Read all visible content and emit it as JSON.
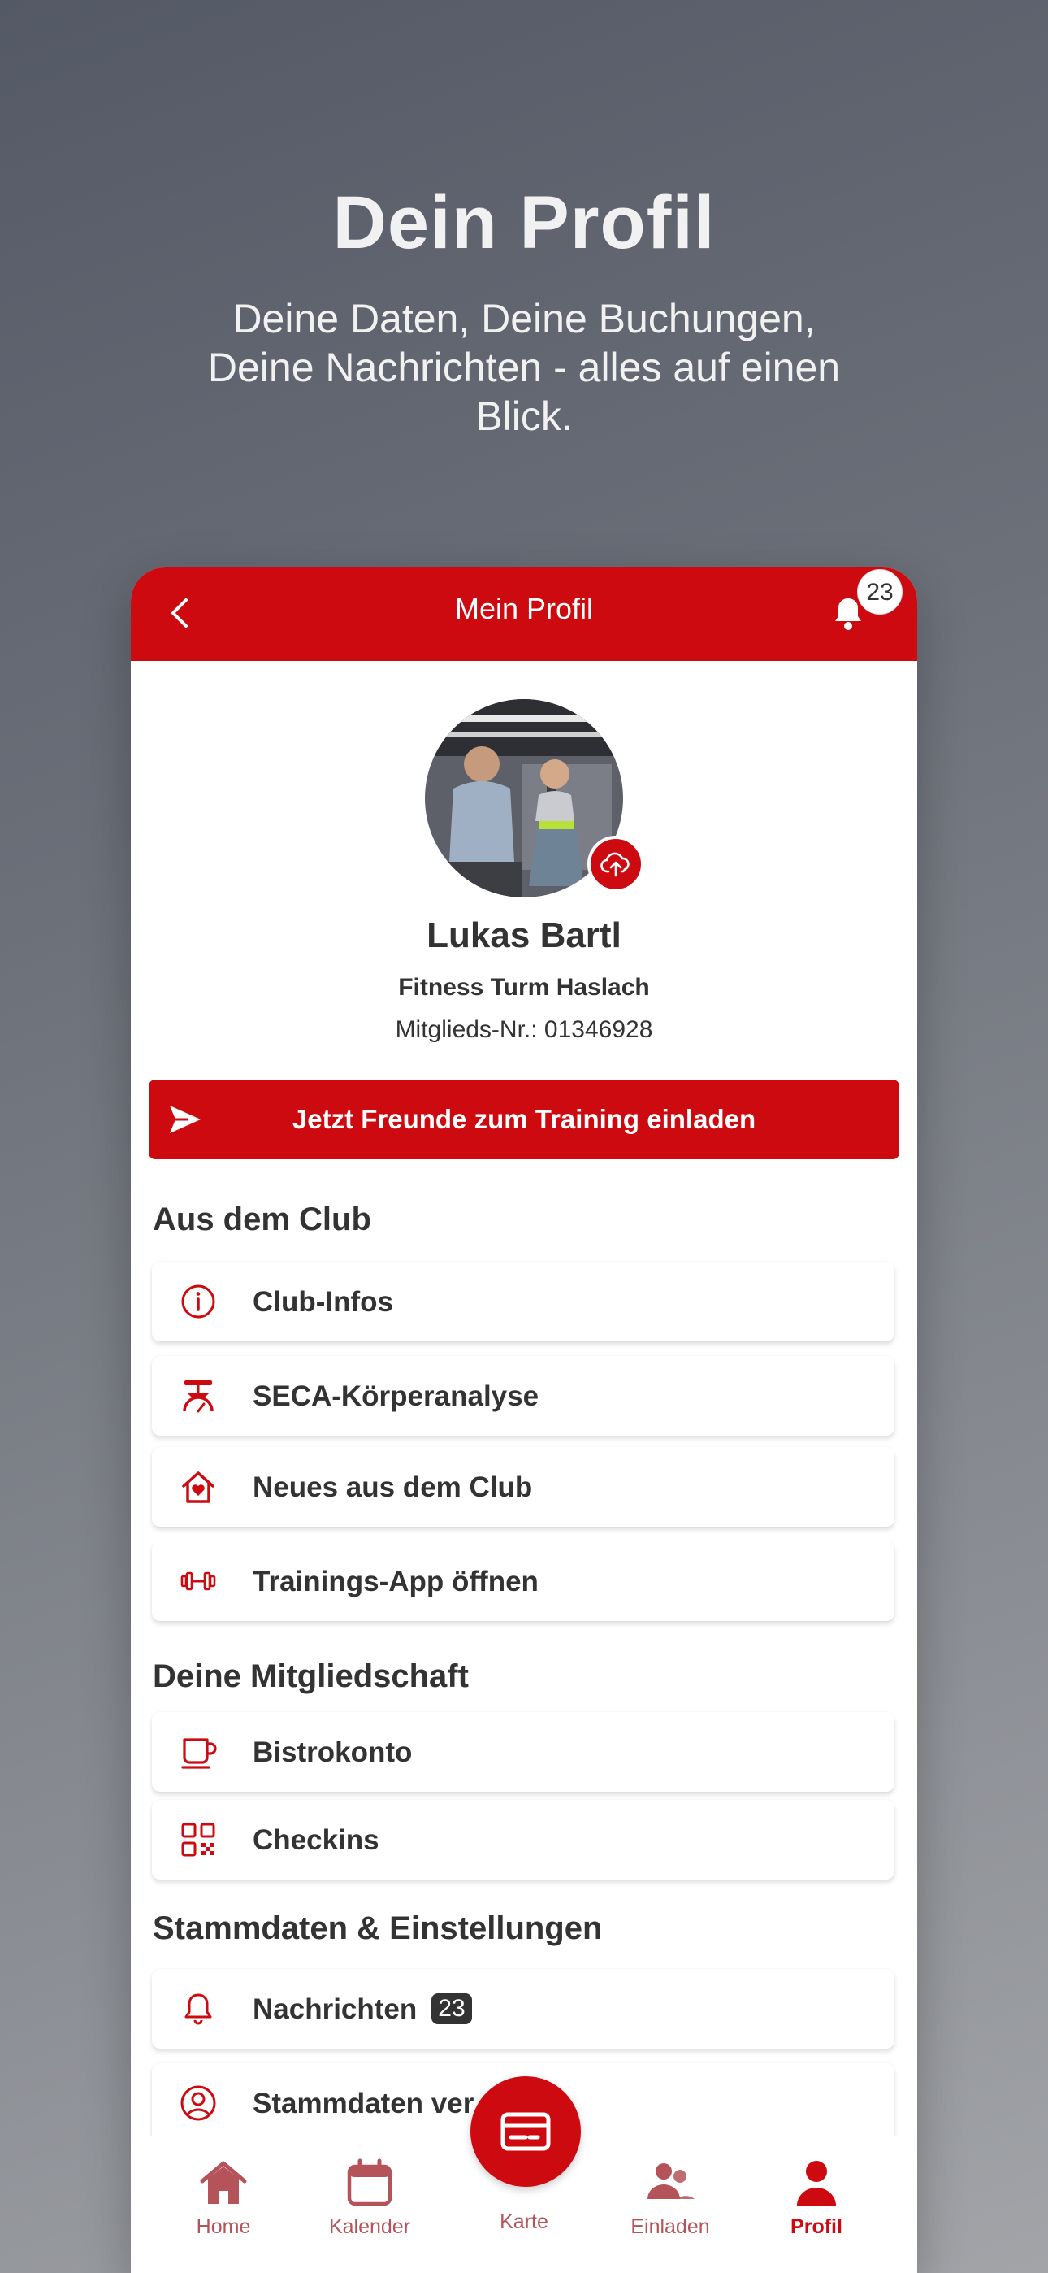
{
  "promo": {
    "title": "Dein Profil",
    "subtitle": "Deine Daten, Deine Buchungen, Deine Nachrichten - alles auf einen Blick."
  },
  "header": {
    "title": "Mein Profil",
    "notification_count": "23"
  },
  "profile": {
    "name": "Lukas Bartl",
    "club": "Fitness Turm Haslach",
    "member_number": "Mitglieds-Nr.: 01346928"
  },
  "invite_button": {
    "label": "Jetzt Freunde zum Training einladen"
  },
  "sections": {
    "club": {
      "title": "Aus dem Club",
      "items": [
        {
          "label": "Club-Infos",
          "icon": "info-icon"
        },
        {
          "label": "SECA-Körperanalyse",
          "icon": "scale-icon"
        },
        {
          "label": "Neues aus dem Club",
          "icon": "house-heart-icon"
        },
        {
          "label": "Trainings-App öffnen",
          "icon": "dumbbell-icon"
        }
      ]
    },
    "membership": {
      "title": "Deine Mitgliedschaft",
      "items": [
        {
          "label": "Bistrokonto",
          "icon": "cup-icon"
        },
        {
          "label": "Checkins",
          "icon": "qr-code-icon"
        }
      ]
    },
    "settings": {
      "title": "Stammdaten & Einstellungen",
      "items": [
        {
          "label": "Nachrichten",
          "badge": "23",
          "icon": "bell-icon"
        },
        {
          "label": "Stammdaten ver",
          "icon": "user-circle-icon"
        }
      ]
    }
  },
  "tabbar": {
    "items": [
      {
        "label": "Home",
        "icon": "home-icon"
      },
      {
        "label": "Kalender",
        "icon": "calendar-icon"
      },
      {
        "label": "Karte",
        "icon": "card-icon"
      },
      {
        "label": "Einladen",
        "icon": "users-icon"
      },
      {
        "label": "Profil",
        "icon": "person-icon",
        "active": true
      }
    ]
  },
  "colors": {
    "brand_red": "#cc0a10",
    "tab_inactive": "#b4535a",
    "text_dark": "#333333"
  }
}
